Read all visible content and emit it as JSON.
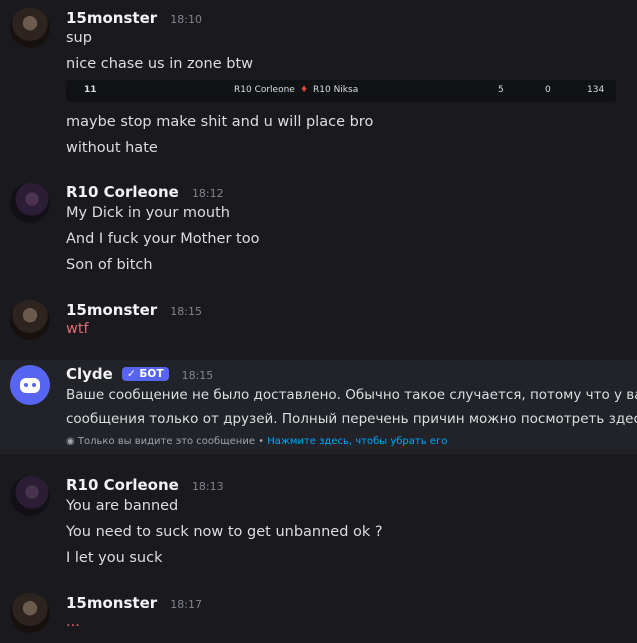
{
  "messages": [
    {
      "username": "15monster",
      "time": "18:10",
      "lines": [
        "sup",
        "nice chase us in zone btw"
      ],
      "embed": {
        "rank": "11",
        "player1": "R10 Corleone",
        "player2": "R10 Niksa",
        "stat1": "5",
        "stat2": "0",
        "stat3": "134"
      },
      "lines_after": [
        "maybe stop make shit and u will place bro",
        "without hate"
      ]
    },
    {
      "username": "R10 Corleone",
      "time": "18:12",
      "lines": [
        "My Dick in your mouth",
        "And I fuck your Mother too",
        "Son of bitch"
      ]
    },
    {
      "username": "15monster",
      "time": "18:15",
      "lines": [
        "wtf"
      ]
    },
    {
      "username": "Clyde",
      "badge": "БОТ",
      "time": "18:15",
      "lines": [
        "Ваше сообщение не было доставлено. Обычно такое случается, потому что у вас",
        "сообщения только от друзей. Полный перечень причин можно посмотреть здесь:"
      ],
      "ephemeral_text": "Только вы видите это сообщение •",
      "ephemeral_link": "Нажмите здесь, чтобы убрать его"
    },
    {
      "username": "R10 Corleone",
      "time": "18:13",
      "lines": [
        "You are banned",
        "You need to suck now to get unbanned ok ?",
        "I let you suck"
      ]
    },
    {
      "username": "15monster",
      "time": "18:17",
      "lines": [
        "..."
      ]
    }
  ],
  "colors": {
    "background": "#1a1a1e",
    "red_text": "#e06a72",
    "bot_badge": "#5865f2",
    "link": "#00a8fc"
  }
}
